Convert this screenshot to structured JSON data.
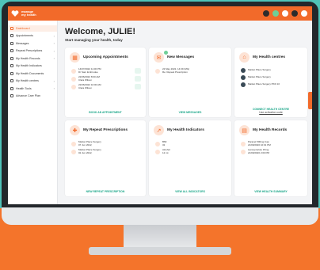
{
  "logo": {
    "line1": "manage",
    "line2": "my health"
  },
  "sidebar": {
    "items": [
      {
        "label": "Dashboard",
        "chevron": false
      },
      {
        "label": "Appointments",
        "chevron": true
      },
      {
        "label": "Messages",
        "chevron": true
      },
      {
        "label": "Repeat Prescriptions",
        "chevron": true
      },
      {
        "label": "My Health Records",
        "chevron": true
      },
      {
        "label": "My Health Indicators",
        "chevron": false
      },
      {
        "label": "My Health Documents",
        "chevron": false
      },
      {
        "label": "My Health centres",
        "chevron": true
      },
      {
        "label": "Health Tools",
        "chevron": true
      },
      {
        "label": "Advance Care Plan",
        "chevron": false
      }
    ]
  },
  "header": {
    "welcome": "Welcome, JULIE!",
    "subtitle": "Start managing your health, today"
  },
  "cards": {
    "appointments": {
      "title": "Upcoming Appointments",
      "link": "BOOK AN APPOINTMENT",
      "rows": [
        {
          "line1": "14/07/2022 11:00 PM",
          "line2": "Dr Sam Embrooke"
        },
        {
          "line1": "22/06/2022 8:00 AM",
          "line2": "Clara Wilson"
        },
        {
          "line1": "22/06/2022 10:00 AM",
          "line2": "Clara Wilson"
        }
      ]
    },
    "messages": {
      "title": "New Messages",
      "link": "VIEW MESSAGES",
      "rows": [
        {
          "line1": "22 May 2022, 14:09 (MG)",
          "line2": "Re: Repeat Prescription"
        }
      ]
    },
    "centres": {
      "title": "My Health centres",
      "link": "CONNECT HEALTH CENTRE",
      "sub": "Use activation code",
      "rows": [
        {
          "line1": "Market Place Surgery",
          "line2": ""
        },
        {
          "line1": "Market Place Surgery",
          "line2": ""
        },
        {
          "line1": "Market Place Surgery PKD 10",
          "line2": ""
        }
      ]
    },
    "prescriptions": {
      "title": "My Repeat Prescriptions",
      "link": "NEW REPEAT PRESCRIPTION",
      "rows": [
        {
          "line1": "Market Place Surgery",
          "line2": "07 Jun 2022,"
        },
        {
          "line1": "Market Place Surgery",
          "line2": "02 Jun 2022,"
        }
      ]
    },
    "indicators": {
      "title": "My Health Indicators",
      "link": "VIEW ALL INDICATORS",
      "rows": [
        {
          "line1": "BMI",
          "line2": "32"
        },
        {
          "line1": "Alcohol",
          "line2": "12 mt"
        }
      ]
    },
    "records": {
      "title": "My Health Records",
      "link": "VIEW HEALTH SUMMARY",
      "rows": [
        {
          "line1": "Paracet 500mg Cap",
          "line2": "21/09/2020 10:01 PM"
        },
        {
          "line1": "Lansoprazole 15mg",
          "line2": "21/09/2020 2:00 PM"
        }
      ]
    }
  },
  "colors": {
    "accent": "#f26a2a",
    "link": "#1aa689"
  }
}
